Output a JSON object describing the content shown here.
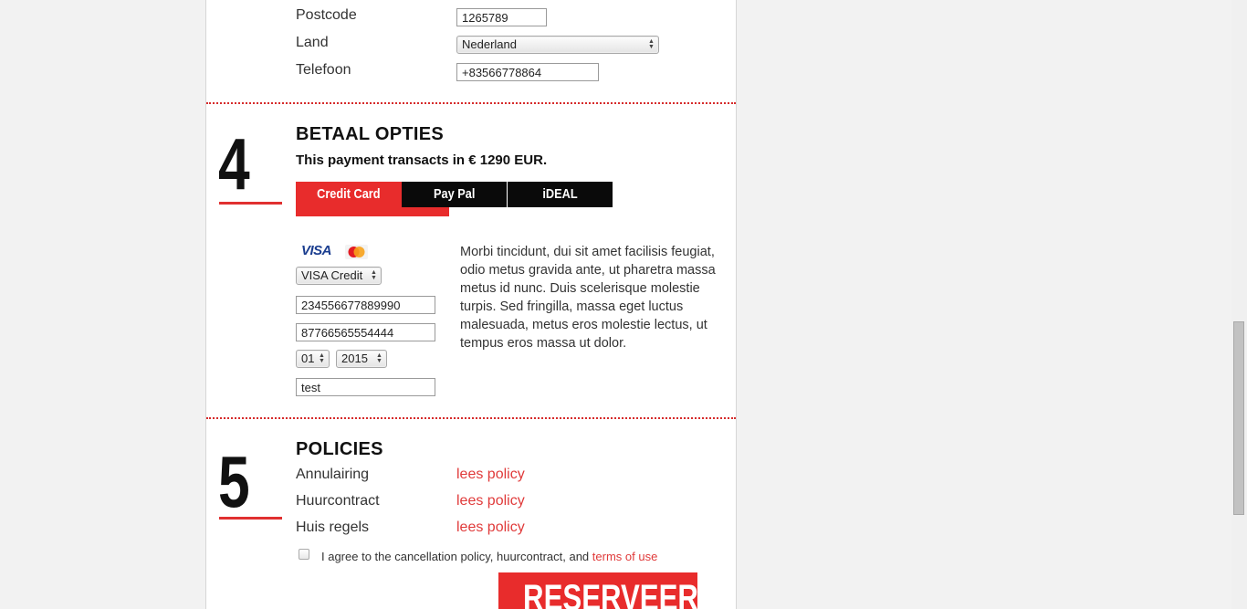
{
  "address": {
    "postcode_label": "Postcode",
    "postcode_value": "1265789",
    "land_label": "Land",
    "land_value": "Nederland",
    "telefoon_label": "Telefoon",
    "telefoon_value": "+83566778864"
  },
  "payment": {
    "step_number": "4",
    "heading": "BETAAL OPTIES",
    "subheading": "This payment transacts in € 1290 EUR.",
    "tabs": [
      {
        "label": "Credit Card",
        "active": true
      },
      {
        "label": "Pay Pal",
        "active": false
      },
      {
        "label": "iDEAL",
        "active": false
      }
    ],
    "card_type": "VISA Credit",
    "card_number": "234556677889990",
    "card_second": "87766565554444",
    "exp_month": "01",
    "exp_year": "2015",
    "name_on_card": "test",
    "description": "Morbi tincidunt, dui sit amet facilisis feugiat, odio metus gravida ante, ut pharetra massa metus id nunc. Duis scelerisque molestie turpis. Sed fringilla, massa eget luctus malesuada, metus eros molestie lectus, ut tempus eros massa ut dolor.",
    "visa_logo_text": "VISA",
    "mastercard_logo_text": "MasterCard"
  },
  "policies": {
    "step_number": "5",
    "heading": "POLICIES",
    "items": [
      {
        "label": "Annulairing",
        "link": "lees policy"
      },
      {
        "label": "Huurcontract",
        "link": "lees policy"
      },
      {
        "label": "Huis regels",
        "link": "lees policy"
      }
    ],
    "agree_text": "I agree to the cancellation policy, huurcontract, and",
    "terms_link": "terms of use",
    "submit_label": "RESERVEER"
  },
  "colors": {
    "accent": "#e82c2c",
    "tab_inactive": "#0a0a0a",
    "link": "#e03a3a"
  }
}
